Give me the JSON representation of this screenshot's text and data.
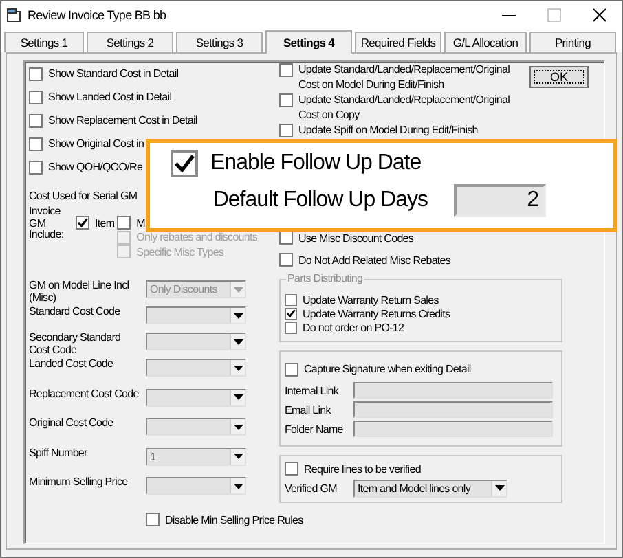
{
  "window": {
    "title": "Review Invoice Type  BB bb"
  },
  "tabs": [
    {
      "label": "Settings 1",
      "selected": false
    },
    {
      "label": "Settings 2",
      "selected": false
    },
    {
      "label": "Settings 3",
      "selected": false
    },
    {
      "label": "Settings 4",
      "selected": true
    },
    {
      "label": "Required Fields",
      "selected": false
    },
    {
      "label": "G/L Allocation",
      "selected": false
    },
    {
      "label": "Printing",
      "selected": false
    }
  ],
  "left": {
    "checkboxes": [
      {
        "label": "Show Standard Cost in Detail",
        "checked": false
      },
      {
        "label": "Show Landed Cost in Detail",
        "checked": false
      },
      {
        "label": "Show Replacement Cost in Detail",
        "checked": false
      },
      {
        "label": "Show Original Cost in",
        "checked": false
      },
      {
        "label": "Show QOH/QOO/Re",
        "checked": false
      }
    ],
    "serial_gm": {
      "heading": "Cost Used for Serial GM",
      "label": "Invoice GM Include:",
      "options": [
        {
          "label": "Item",
          "checked": true,
          "disabled": false
        },
        {
          "label": "M",
          "checked": false,
          "disabled": false
        },
        {
          "label": "Only rebates and discounts",
          "checked": false,
          "disabled": true
        },
        {
          "label": "Specific Misc Types",
          "checked": false,
          "disabled": true
        }
      ]
    },
    "fields": [
      {
        "label": "GM on Model Line Incl (Misc)",
        "value": "Only Discounts",
        "disabled": true
      },
      {
        "label": "Standard Cost Code",
        "disabled": false
      },
      {
        "label": "Secondary Standard Cost Code",
        "disabled": false
      },
      {
        "label": "Landed Cost Code",
        "disabled": false
      },
      {
        "label": "Replacement Cost Code",
        "disabled": false
      },
      {
        "label": "Original Cost Code",
        "disabled": false
      },
      {
        "label": "Spiff Number",
        "value": "1",
        "disabled": false
      },
      {
        "label": "Minimum Selling Price",
        "disabled": false
      }
    ],
    "disable_rules": {
      "label": "Disable Min Selling Price Rules",
      "checked": false
    }
  },
  "right": {
    "checkboxes": [
      {
        "label": "Update Standard/Landed/Replacement/Original Cost on Model During Edit/Finish",
        "checked": false
      },
      {
        "label": "Update Standard/Landed/Replacement/Original Cost on Copy",
        "checked": false
      },
      {
        "label": "Update Spiff on Model During Edit/Finish",
        "checked": false
      }
    ],
    "more_checkboxes": [
      {
        "label": "Use Misc Discount Codes",
        "checked": false
      },
      {
        "label": "Do Not Add Related Misc Rebates",
        "checked": false
      }
    ],
    "parts_distributing": {
      "title": "Parts Distributing",
      "checkboxes": [
        {
          "label": "Update Warranty Return Sales",
          "checked": false
        },
        {
          "label": "Update Warranty Returns Credits",
          "checked": true
        },
        {
          "label": "Do not order on PO-12",
          "checked": false
        }
      ]
    },
    "signature": {
      "checkbox": {
        "label": "Capture Signature when exiting Detail",
        "checked": false
      },
      "fields": [
        {
          "label": "Internal Link"
        },
        {
          "label": "Email Link"
        },
        {
          "label": "Folder Name"
        }
      ]
    },
    "verify": {
      "checkbox": {
        "label": "Require lines to be verified",
        "checked": false
      },
      "label": "Verified GM",
      "value": "Item and Model lines only"
    }
  },
  "ok_button": "OK",
  "callout": {
    "enable": {
      "label": "Enable Follow Up Date",
      "checked": true
    },
    "days": {
      "label": "Default Follow Up Days",
      "value": "2"
    }
  }
}
